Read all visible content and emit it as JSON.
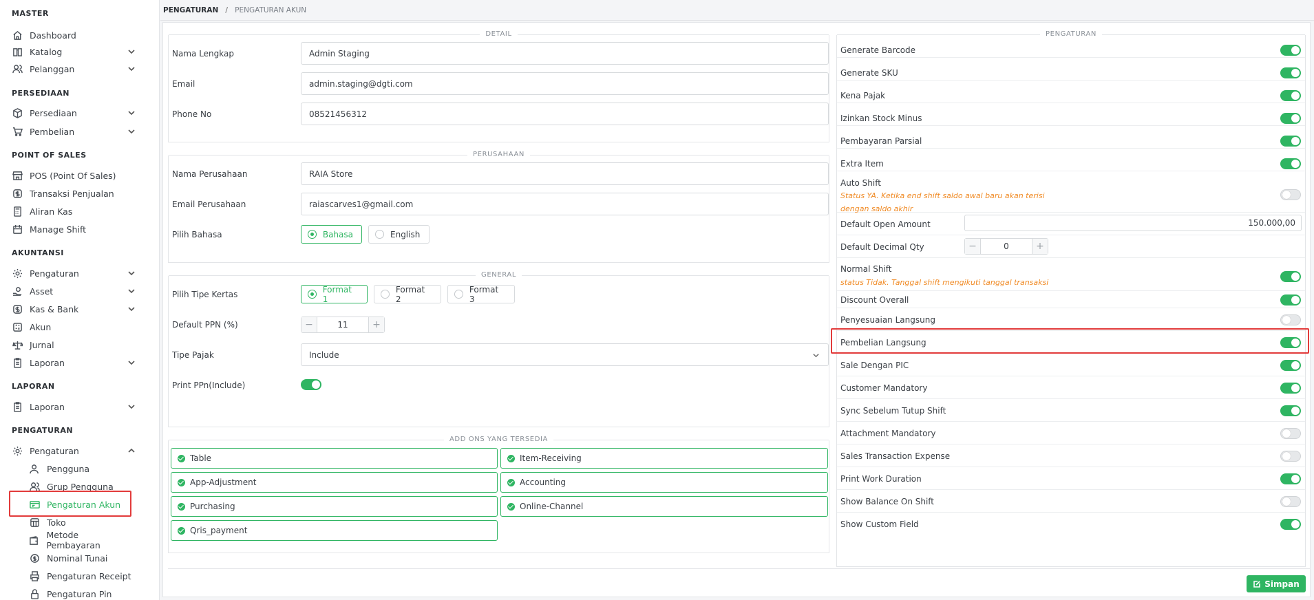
{
  "sidebar": {
    "sections": [
      "MASTER",
      "PERSEDIAAN",
      "POINT OF SALES",
      "AKUNTANSI",
      "LAPORAN",
      "PENGATURAN"
    ],
    "items": {
      "dashboard": "Dashboard",
      "katalog": "Katalog",
      "pelanggan": "Pelanggan",
      "persediaan": "Persediaan",
      "pembelian": "Pembelian",
      "pos": "POS (Point Of Sales)",
      "transaksi": "Transaksi Penjualan",
      "aliran_kas": "Aliran Kas",
      "manage_shift": "Manage Shift",
      "pengaturan_akt": "Pengaturan",
      "asset": "Asset",
      "kas_bank": "Kas & Bank",
      "akun": "Akun",
      "jurnal": "Jurnal",
      "laporan_akt": "Laporan",
      "laporan": "Laporan",
      "pengaturan": "Pengaturan",
      "pengguna": "Pengguna",
      "grup_pengguna": "Grup Pengguna",
      "pengaturan_akun": "Pengaturan Akun",
      "toko": "Toko",
      "metode_pembayaran": "Metode Pembayaran",
      "nominal_tunai": "Nominal Tunai",
      "pengaturan_receipt": "Pengaturan Receipt",
      "pengaturan_pin": "Pengaturan Pin"
    }
  },
  "breadcrumb": {
    "root": "PENGATURAN",
    "sep": "/",
    "current": "PENGATURAN AKUN"
  },
  "detail": {
    "title": "DETAIL",
    "nama_label": "Nama Lengkap",
    "nama_value": "Admin Staging",
    "email_label": "Email",
    "email_value": "admin.staging@dgti.com",
    "phone_label": "Phone No",
    "phone_value": "08521456312"
  },
  "perusahaan": {
    "title": "PERUSAHAAN",
    "nama_label": "Nama Perusahaan",
    "nama_value": "RAIA Store",
    "email_label": "Email Perusahaan",
    "email_value": "raiascarves1@gmail.com",
    "bahasa_label": "Pilih Bahasa",
    "bahasa_opt1": "Bahasa",
    "bahasa_opt2": "English"
  },
  "general": {
    "title": "GENERAL",
    "kertas_label": "Pilih Tipe Kertas",
    "format1": "Format 1",
    "format2": "Format 2",
    "format3": "Format 3",
    "ppn_label": "Default PPN (%)",
    "ppn_value": "11",
    "pajak_label": "Tipe Pajak",
    "pajak_value": "Include",
    "print_ppn_label": "Print PPn(Include)"
  },
  "addons": {
    "title": "ADD ONS YANG TERSEDIA",
    "items": [
      "Table",
      "Item-Receiving",
      "App-Adjustment",
      "Accounting",
      "Purchasing",
      "Online-Channel",
      "Qris_payment"
    ]
  },
  "pengaturan": {
    "title": "PENGATURAN",
    "generate_barcode": "Generate Barcode",
    "generate_sku": "Generate SKU",
    "kena_pajak": "Kena Pajak",
    "izinkan_stock": "Izinkan Stock Minus",
    "pembayaran_parsial": "Pembayaran Parsial",
    "extra_item": "Extra Item",
    "auto_shift": "Auto Shift",
    "auto_shift_note1": "Status YA. Ketika end shift saldo awal baru akan terisi",
    "auto_shift_note2": "dengan saldo akhir",
    "default_open_amount": "Default Open Amount",
    "default_open_amount_value": "150.000,00",
    "default_decimal_qty": "Default Decimal Qty",
    "default_decimal_value": "0",
    "normal_shift": "Normal Shift",
    "normal_shift_note": "status Tidak. Tanggal shift mengikuti tanggal transaksi",
    "discount_overall": "Discount Overall",
    "penyesuaian_langsung": "Penyesuaian Langsung",
    "pembelian_langsung": "Pembelian Langsung",
    "sale_dengan_pic": "Sale Dengan PIC",
    "customer_mandatory": "Customer Mandatory",
    "sync_sebelum": "Sync Sebelum Tutup Shift",
    "attachment_mandatory": "Attachment Mandatory",
    "sales_transaction_expense": "Sales Transaction Expense",
    "print_work_duration": "Print Work Duration",
    "show_balance": "Show Balance On Shift",
    "show_custom_field": "Show Custom Field"
  },
  "toggles": {
    "print_ppn": true,
    "generate_barcode": true,
    "generate_sku": true,
    "kena_pajak": true,
    "izinkan_stock": true,
    "pembayaran_parsial": true,
    "extra_item": true,
    "auto_shift": false,
    "normal_shift": true,
    "discount_overall": true,
    "penyesuaian_langsung": false,
    "pembelian_langsung": true,
    "sale_dengan_pic": true,
    "customer_mandatory": true,
    "sync_sebelum": true,
    "attachment_mandatory": false,
    "sales_transaction_expense": false,
    "print_work_duration": true,
    "show_balance": false,
    "show_custom_field": true
  },
  "stepper": {
    "minus": "−",
    "plus": "+"
  },
  "save_label": "Simpan",
  "colors": {
    "accent": "#2fb562",
    "highlight": "#e23b3b",
    "note": "#f08a24"
  }
}
